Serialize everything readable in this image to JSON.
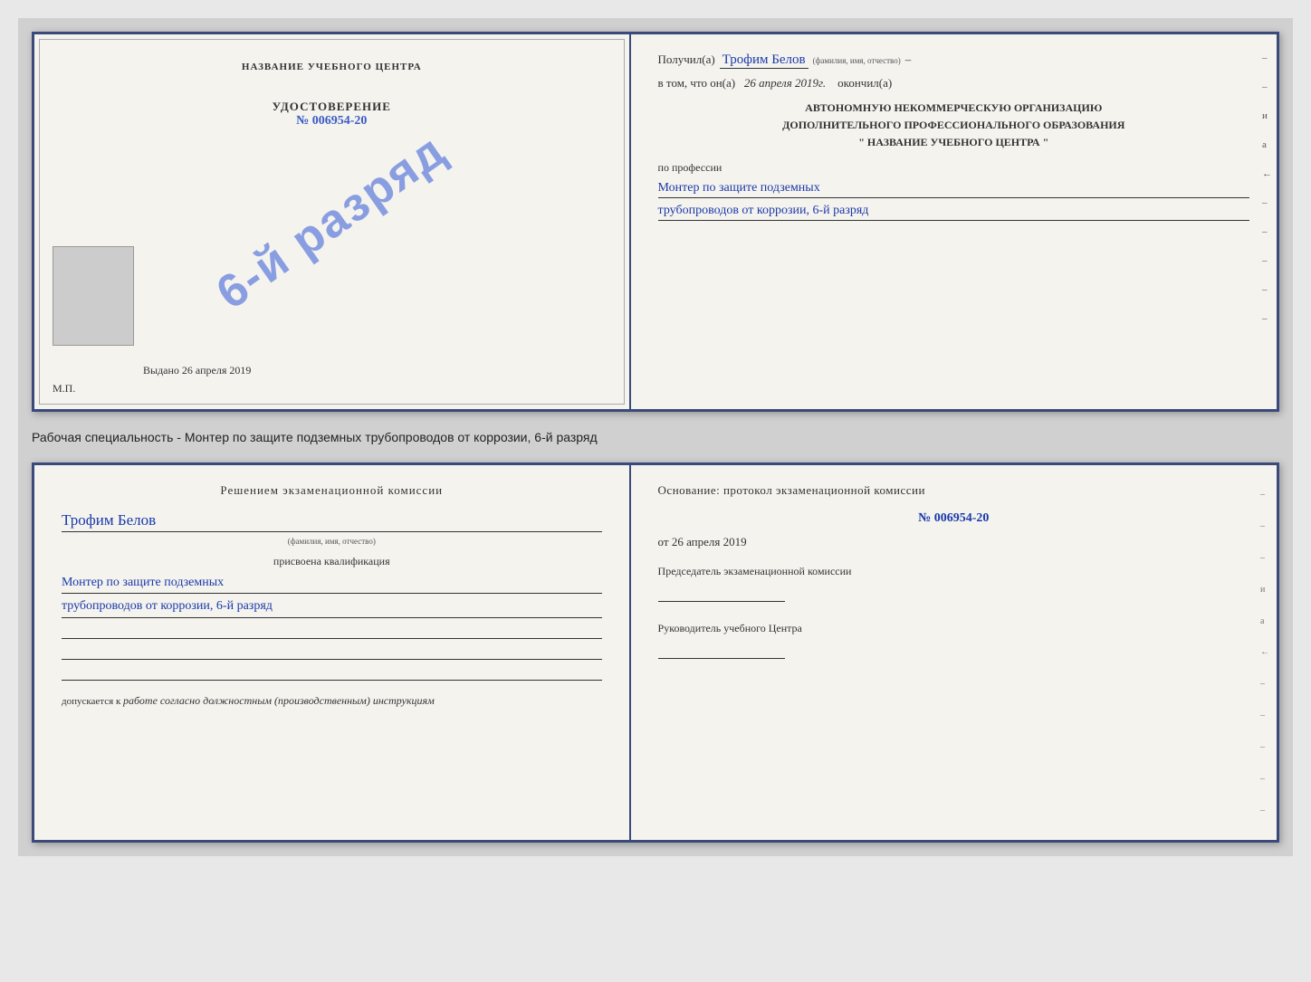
{
  "page": {
    "background": "#d0d0d0"
  },
  "top_certificate": {
    "left": {
      "org_name": "НАЗВАНИЕ УЧЕБНОГО ЦЕНТРА",
      "stamp_text": "6-й разряд",
      "cert_title": "УДОСТОВЕРЕНИЕ",
      "cert_number_prefix": "№",
      "cert_number": "006954-20",
      "issue_label": "Выдано",
      "issue_date": "26 апреля 2019",
      "mp_label": "М.П."
    },
    "right": {
      "received_label": "Получил(а)",
      "recipient_name": "Трофим Белов",
      "fio_sub": "(фамилия, имя, отчество)",
      "dash": "–",
      "date_label": "в том, что он(а)",
      "date_value": "26 апреля 2019г.",
      "finished_label": "окончил(а)",
      "org_line1": "АВТОНОМНУЮ НЕКОММЕРЧЕСКУЮ ОРГАНИЗАЦИЮ",
      "org_line2": "ДОПОЛНИТЕЛЬНОГО ПРОФЕССИОНАЛЬНОГО ОБРАЗОВАНИЯ",
      "org_line3": "\"  НАЗВАНИЕ УЧЕБНОГО ЦЕНТРА  \"",
      "profession_label": "по профессии",
      "profession_line1": "Монтер по защите подземных",
      "profession_line2": "трубопроводов от коррозии, 6-й разряд"
    }
  },
  "specialty_text": "Рабочая специальность - Монтер по защите подземных трубопроводов от коррозии, 6-й разряд",
  "bottom_certificate": {
    "left": {
      "decision_title": "Решением  экзаменационной  комиссии",
      "full_name": "Трофим Белов",
      "fio_sub": "(фамилия, имя, отчество)",
      "qualification_label": "присвоена квалификация",
      "qual_line1": "Монтер по защите подземных",
      "qual_line2": "трубопроводов от коррозии, 6-й разряд",
      "allowed_prefix": "допускается к",
      "allowed_text": "работе согласно должностным (производственным) инструкциям"
    },
    "right": {
      "basis_label": "Основание: протокол экзаменационной  комиссии",
      "protocol_number": "№  006954-20",
      "date_prefix": "от",
      "date_value": "26 апреля 2019",
      "chairman_label": "Председатель экзаменационной комиссии",
      "director_label": "Руководитель учебного Центра"
    }
  },
  "margin_dashes": [
    "-",
    "-",
    "-",
    "и",
    "а",
    "←",
    "-",
    "-",
    "-",
    "-",
    "-"
  ]
}
